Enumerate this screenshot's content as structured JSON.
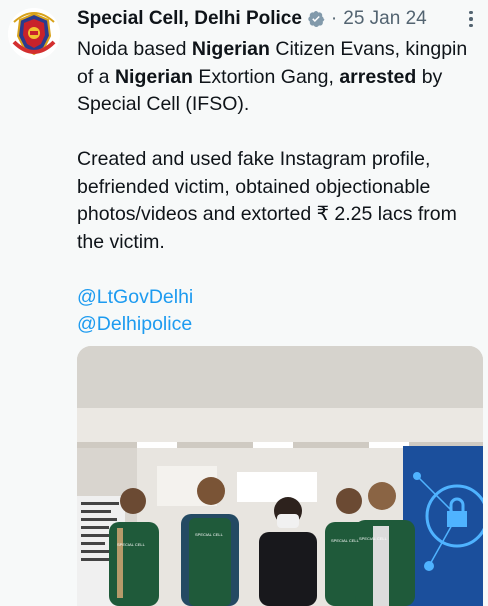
{
  "tweet": {
    "author_name": "Special Cell, Delhi Police",
    "verified": true,
    "separator": "·",
    "date": "25 Jan 24",
    "paragraph1": {
      "t1": "Noida based ",
      "b1": "Nigerian",
      "t2": " Citizen Evans, kingpin of a ",
      "b2": "Nigerian",
      "t3": " Extortion Gang, ",
      "b3": "arrested",
      "t4": " by Special Cell (IFSO)."
    },
    "paragraph2": "Created and used fake Instagram profile, befriended victim, obtained objectionable photos/videos and extorted ₹ 2.25 lacs from the victim.",
    "mentions": [
      "@LtGovDelhi",
      "@Delhipolice"
    ]
  },
  "icons": {
    "verified_color": "#829aab",
    "more": "more-vertical-icon"
  },
  "colors": {
    "link": "#1d9bf0",
    "muted": "#536471",
    "text": "#0f1419",
    "background": "#f7f9f9"
  },
  "media": {
    "vest_text": "SPECIAL CELL"
  }
}
